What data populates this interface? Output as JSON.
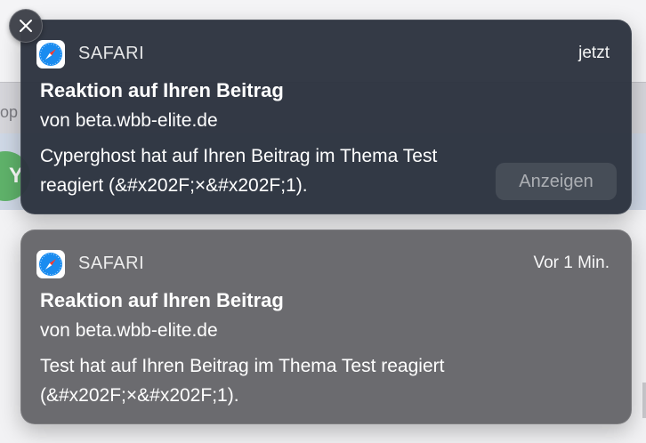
{
  "background": {
    "partial_text": "op",
    "avatar_letter": "Y"
  },
  "notifications": [
    {
      "app_name": "SAFARI",
      "icon": "safari-compass-icon",
      "timestamp": "jetzt",
      "title": "Reaktion auf Ihren Beitrag",
      "subtitle": "von beta.wbb-elite.de",
      "body_line_1": "Cyperghost hat auf Ihren Beitrag im Thema Test",
      "body_line_2": "reagiert (&#x202F;×&#x202F;1).",
      "action_label": "Anzeigen"
    },
    {
      "app_name": "SAFARI",
      "icon": "safari-compass-icon",
      "timestamp": "Vor 1 Min.",
      "title": "Reaktion auf Ihren Beitrag",
      "subtitle": "von beta.wbb-elite.de",
      "body_line_1": "Test hat auf Ihren Beitrag im Thema Test reagiert",
      "body_line_2": "(&#x202F;×&#x202F;1)."
    }
  ],
  "close_icon": "close-x-icon",
  "colors": {
    "notification_primary_bg": "#2c323e",
    "notification_secondary_bg": "#66666a",
    "safari_blue": "#1a8cf0"
  }
}
